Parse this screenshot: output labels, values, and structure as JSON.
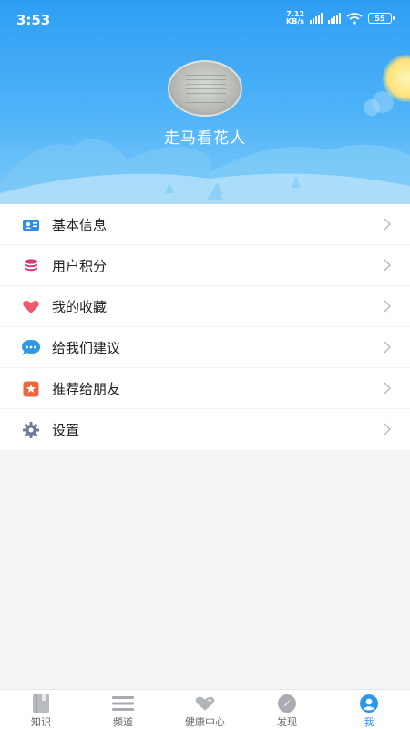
{
  "status_bar": {
    "time": "3:53",
    "net_speed_value": "7.12",
    "net_speed_unit": "KB/s",
    "battery": "55"
  },
  "profile": {
    "username": "走马看花人"
  },
  "menu": {
    "items": [
      {
        "label": "基本信息",
        "icon": "id-card-icon",
        "color": "#2f8de4"
      },
      {
        "label": "用户积分",
        "icon": "coin-stack-icon",
        "color": "#d63a7a"
      },
      {
        "label": "我的收藏",
        "icon": "heart-icon",
        "color": "#f05a6e"
      },
      {
        "label": "给我们建议",
        "icon": "chat-bubble-icon",
        "color": "#2f98e6"
      },
      {
        "label": "推荐给朋友",
        "icon": "star-badge-icon",
        "color": "#f0643c"
      },
      {
        "label": "设置",
        "icon": "gear-icon",
        "color": "#6c7a99"
      }
    ]
  },
  "tabbar": {
    "tabs": [
      {
        "label": "知识",
        "icon": "book-icon"
      },
      {
        "label": "频道",
        "icon": "menu-lines-icon"
      },
      {
        "label": "健康中心",
        "icon": "heart-plus-icon"
      },
      {
        "label": "发现",
        "icon": "compass-icon"
      },
      {
        "label": "我",
        "icon": "user-icon",
        "active": true
      }
    ]
  },
  "colors": {
    "header_blue": "#2e9ef4",
    "accent": "#2f98e6",
    "background": "#f2f4f5"
  }
}
